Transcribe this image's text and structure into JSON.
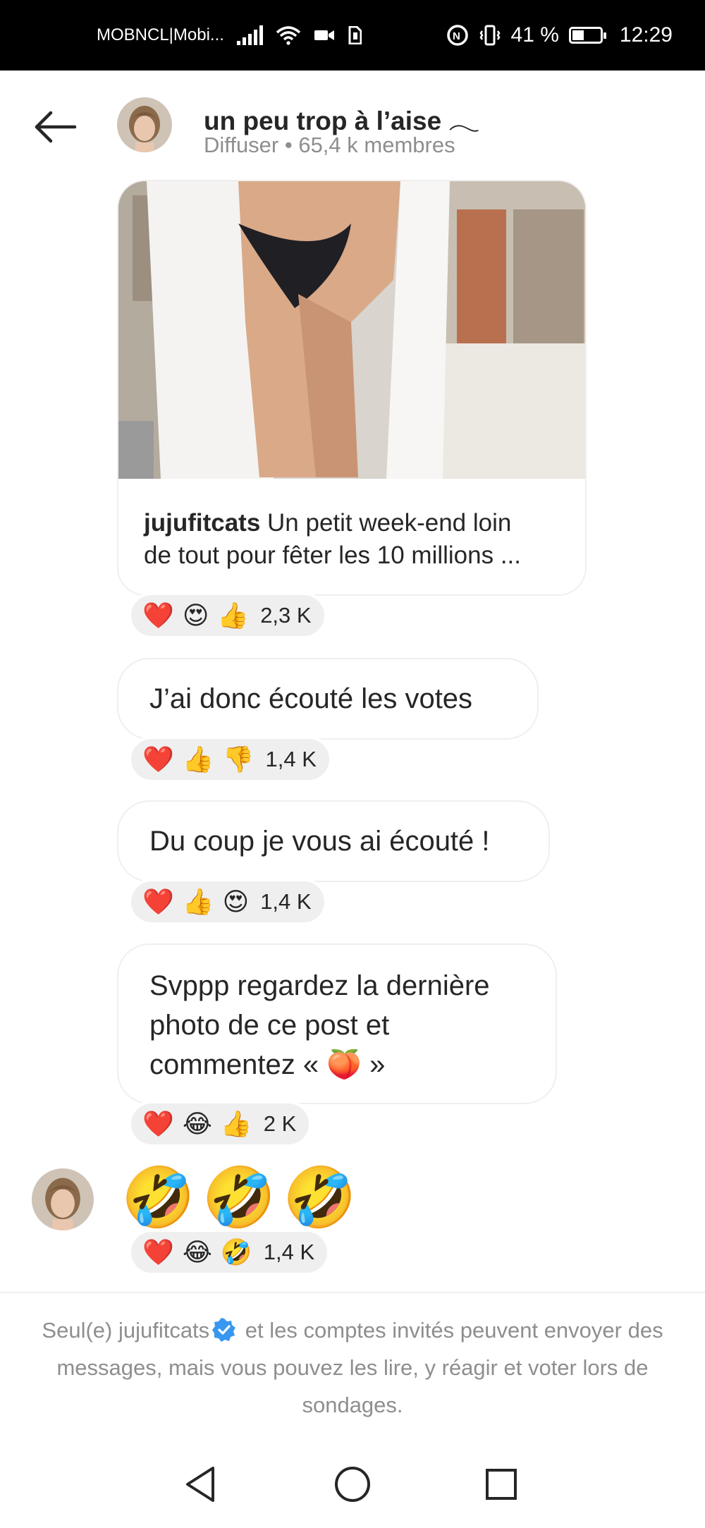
{
  "status_bar": {
    "carrier": "MOBNCL|Mobi...",
    "battery_level": "41 %",
    "time": "12:29",
    "icons": [
      "signal-icon",
      "wifi-icon",
      "video-icon",
      "sim-icon",
      "data-saver-icon",
      "vibrate-icon",
      "battery-icon"
    ]
  },
  "header": {
    "title": "un peu trop à l’aise 𓂃",
    "subtitle": "Diffuser • 65,4 k membres",
    "back_icon": "arrow-left-icon"
  },
  "messages": [
    {
      "type": "post",
      "author": "jujufitcats",
      "caption_line1": " Un petit week-end loin",
      "caption_line2": "de tout pour fêter les 10 millions ...",
      "reactions": [
        "❤️",
        "😍",
        "👍"
      ],
      "reaction_count": "2,3 K"
    },
    {
      "type": "text",
      "text": "J’ai donc écouté les votes",
      "reactions": [
        "❤️",
        "👍",
        "👎"
      ],
      "reaction_count": "1,4 K"
    },
    {
      "type": "text",
      "text": "Du coup je vous ai écouté !",
      "reactions": [
        "❤️",
        "👍",
        "😍"
      ],
      "reaction_count": "1,4 K"
    },
    {
      "type": "text",
      "text_line1": "Svppp regardez la dernière",
      "text_line2": "photo de ce post et",
      "text_line3": "commentez « 🍑 »",
      "reactions": [
        "❤️",
        "😂",
        "👍"
      ],
      "reaction_count": "2 K"
    },
    {
      "type": "emoji",
      "emojis": [
        "🤣",
        "🤣",
        "🤣"
      ],
      "reactions": [
        "❤️",
        "😂",
        "🤣"
      ],
      "reaction_count": "1,4 K"
    }
  ],
  "footer": {
    "part1": "Seul(e) jujufitcats",
    "part2": " et les comptes invités peuvent envoyer des messages, mais vous pouvez les lire, y réagir et voter lors de sondages."
  },
  "nav": {
    "back_icon": "triangle-back-icon",
    "home_icon": "circle-home-icon",
    "recents_icon": "square-recents-icon"
  },
  "colors": {
    "status_bar_bg": "#000000",
    "text_primary": "#262626",
    "text_secondary": "#8e8e8e",
    "bubble_border": "#efefef",
    "verified_blue": "#3897f0"
  }
}
